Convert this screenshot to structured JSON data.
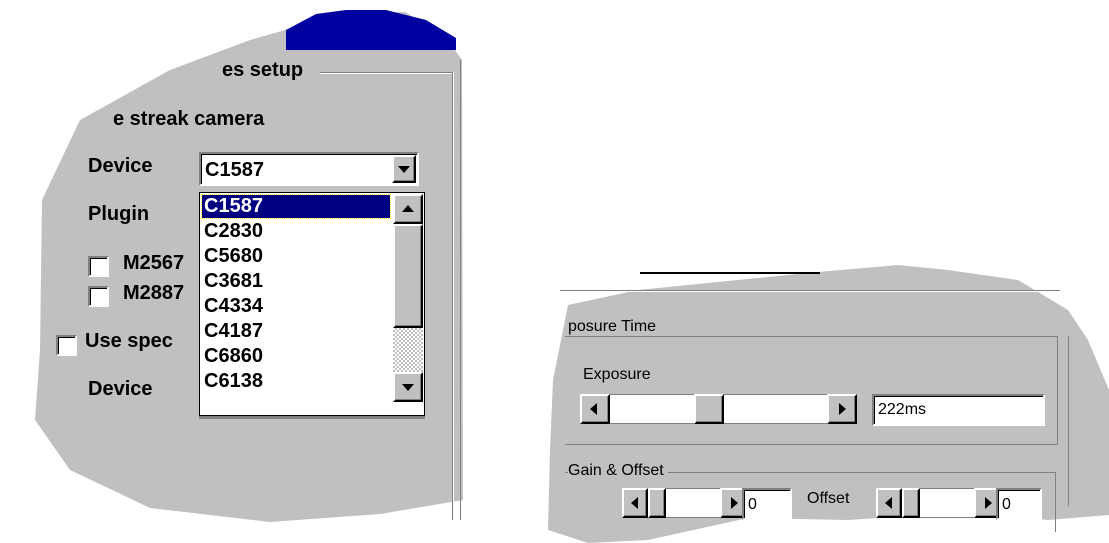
{
  "left": {
    "group_title": "es setup",
    "streak_camera_label": "e streak camera",
    "device_label": "Device",
    "combo_value": "C1587",
    "plugin_label": "Plugin",
    "check1_label": "M2567",
    "check2_label": "M2887",
    "spec_label": "Use spec",
    "device2_label": "Device",
    "dropdown_items": [
      "C1587",
      "C2830",
      "C5680",
      "C3681",
      "C4334",
      "C4187",
      "C6860",
      "C6138"
    ]
  },
  "right": {
    "exposure_group": "posure Time",
    "exposure_label": "Exposure",
    "exposure_value": "222ms",
    "gain_group": "Gain & Offset",
    "gain_value": "0",
    "offset_label": "Offset",
    "offset_value": "0"
  },
  "colors": {
    "panel": "#c0c0c0",
    "selection": "#000080",
    "title_bar": "#0000a0"
  }
}
